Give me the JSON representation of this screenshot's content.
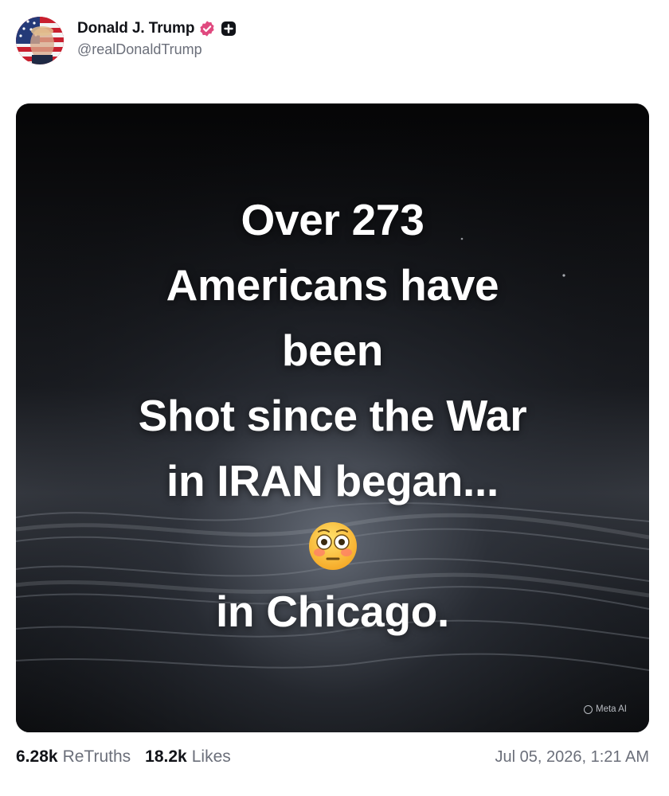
{
  "post": {
    "author": {
      "display_name": "Donald J. Trump",
      "handle": "@realDonaldTrump",
      "verified_icon": "verified-badge-icon",
      "verified_color": "#e0497f",
      "plus_icon": "plus-square-icon"
    },
    "image": {
      "text_lines": [
        "Over 273",
        "Americans have",
        "been",
        "Shot since the War",
        "in IRAN began..."
      ],
      "emoji": "😳",
      "emoji_name": "flushed-face-emoji",
      "final_line": "in Chicago.",
      "watermark": "Meta AI"
    },
    "stats": {
      "retruths_count": "6.28k",
      "retruths_label": "ReTruths",
      "likes_count": "18.2k",
      "likes_label": "Likes"
    },
    "timestamp": "Jul 05, 2026, 1:21 AM"
  }
}
